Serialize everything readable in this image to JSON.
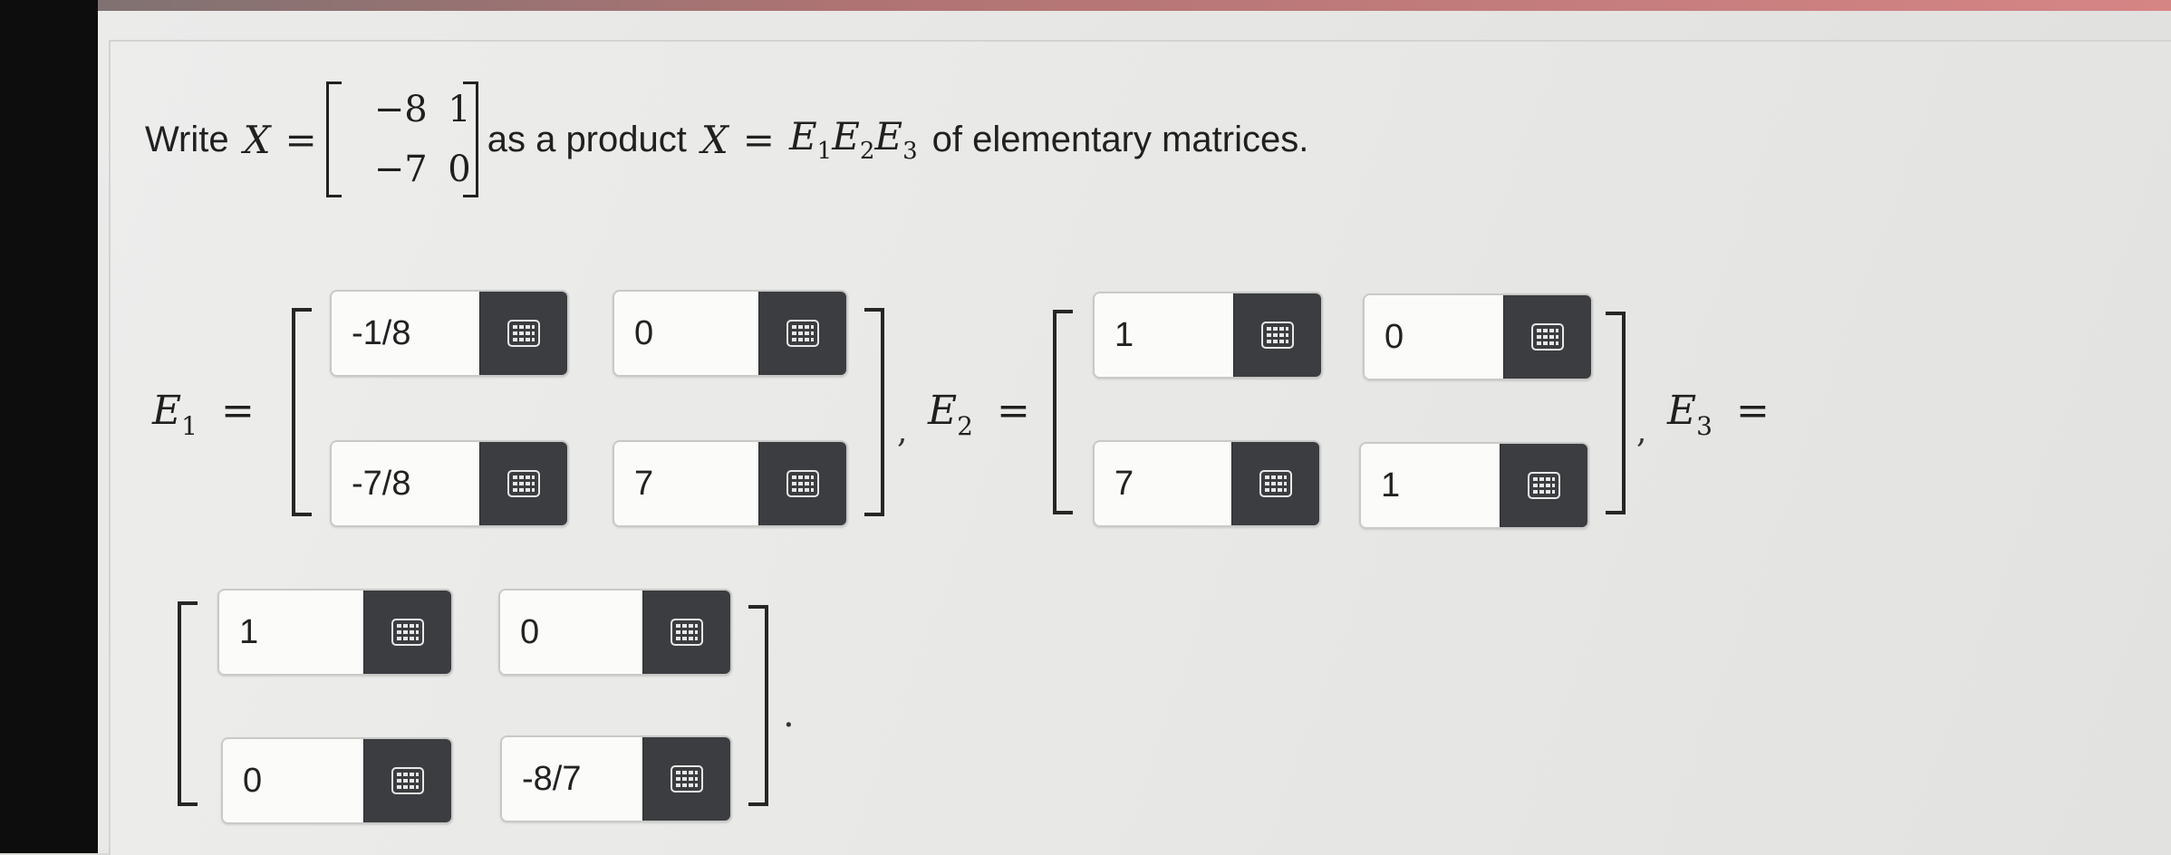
{
  "question": {
    "prefix": "Write",
    "matrix_var": "X",
    "equals": "=",
    "matrix": [
      [
        "−8",
        "1"
      ],
      [
        "−7",
        "0"
      ]
    ],
    "mid_text": "as a product",
    "product_lhs": "X",
    "product_factors": [
      {
        "base": "E",
        "sub": "1"
      },
      {
        "base": "E",
        "sub": "2"
      },
      {
        "base": "E",
        "sub": "3"
      }
    ],
    "suffix": "of elementary matrices."
  },
  "labels": {
    "e1": {
      "base": "E",
      "sub": "1",
      "eq": "="
    },
    "e2": {
      "base": "E",
      "sub": "2",
      "eq": "="
    },
    "e3": {
      "base": "E",
      "sub": "3",
      "eq": "="
    }
  },
  "separators": {
    "comma": ",",
    "period": "."
  },
  "E1": {
    "r1c1": "-1/8",
    "r1c2": "0",
    "r2c1": "-7/8",
    "r2c2": "7"
  },
  "E2": {
    "r1c1": "1",
    "r1c2": "0",
    "r2c1": "7",
    "r2c2": "1"
  },
  "E3": {
    "r1c1": "1",
    "r1c2": "0",
    "r2c1": "0",
    "r2c2": "-8/7"
  },
  "icons": {
    "keypad": "keypad-grid-icon"
  },
  "colors": {
    "keypad_button": "#3b3d40",
    "input_bg": "#fbfbfa"
  }
}
